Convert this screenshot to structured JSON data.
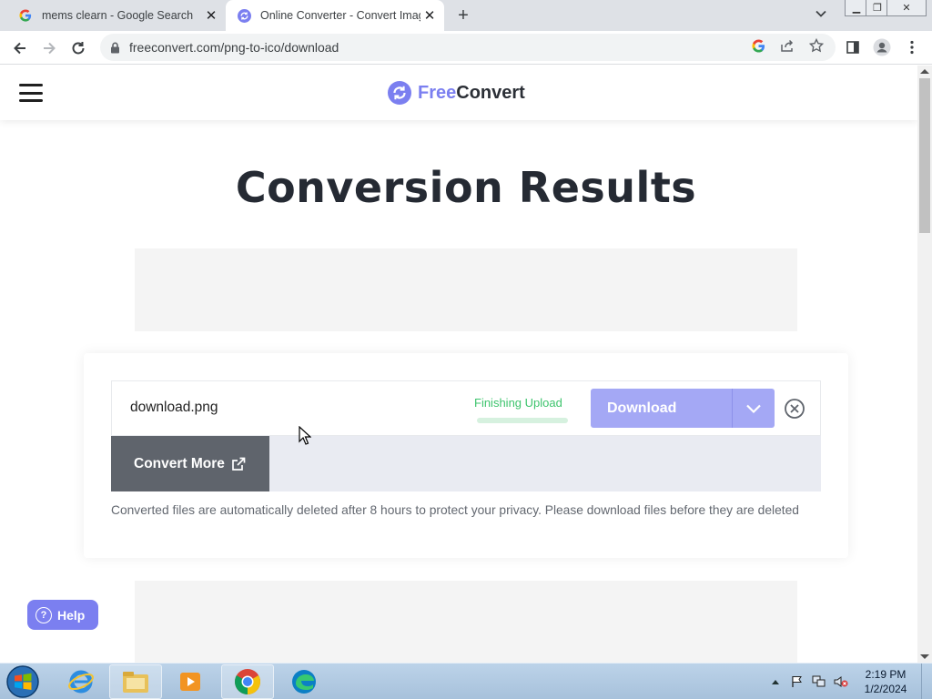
{
  "browser": {
    "tabs": [
      {
        "title": "mems clearn - Google Search",
        "favicon": "google-g-icon",
        "active": false
      },
      {
        "title": "Online Converter - Convert Imag",
        "favicon": "freeconvert-icon",
        "active": true
      }
    ],
    "url": "freeconvert.com/png-to-ico/download"
  },
  "site": {
    "logo_free": "Free",
    "logo_convert": "Convert",
    "brand_color": "#7b7ff0"
  },
  "page": {
    "title": "Conversion Results"
  },
  "result": {
    "file_name": "download.png",
    "status": "Finishing Upload",
    "progress": 1.0,
    "download_label": "Download",
    "convert_more_label": "Convert More",
    "privacy_note": "Converted files are automatically deleted after 8 hours to protect your privacy. Please download files before they are deleted"
  },
  "help": {
    "label": "Help"
  },
  "taskbar": {
    "time": "2:19 PM",
    "date": "1/2/2024"
  }
}
